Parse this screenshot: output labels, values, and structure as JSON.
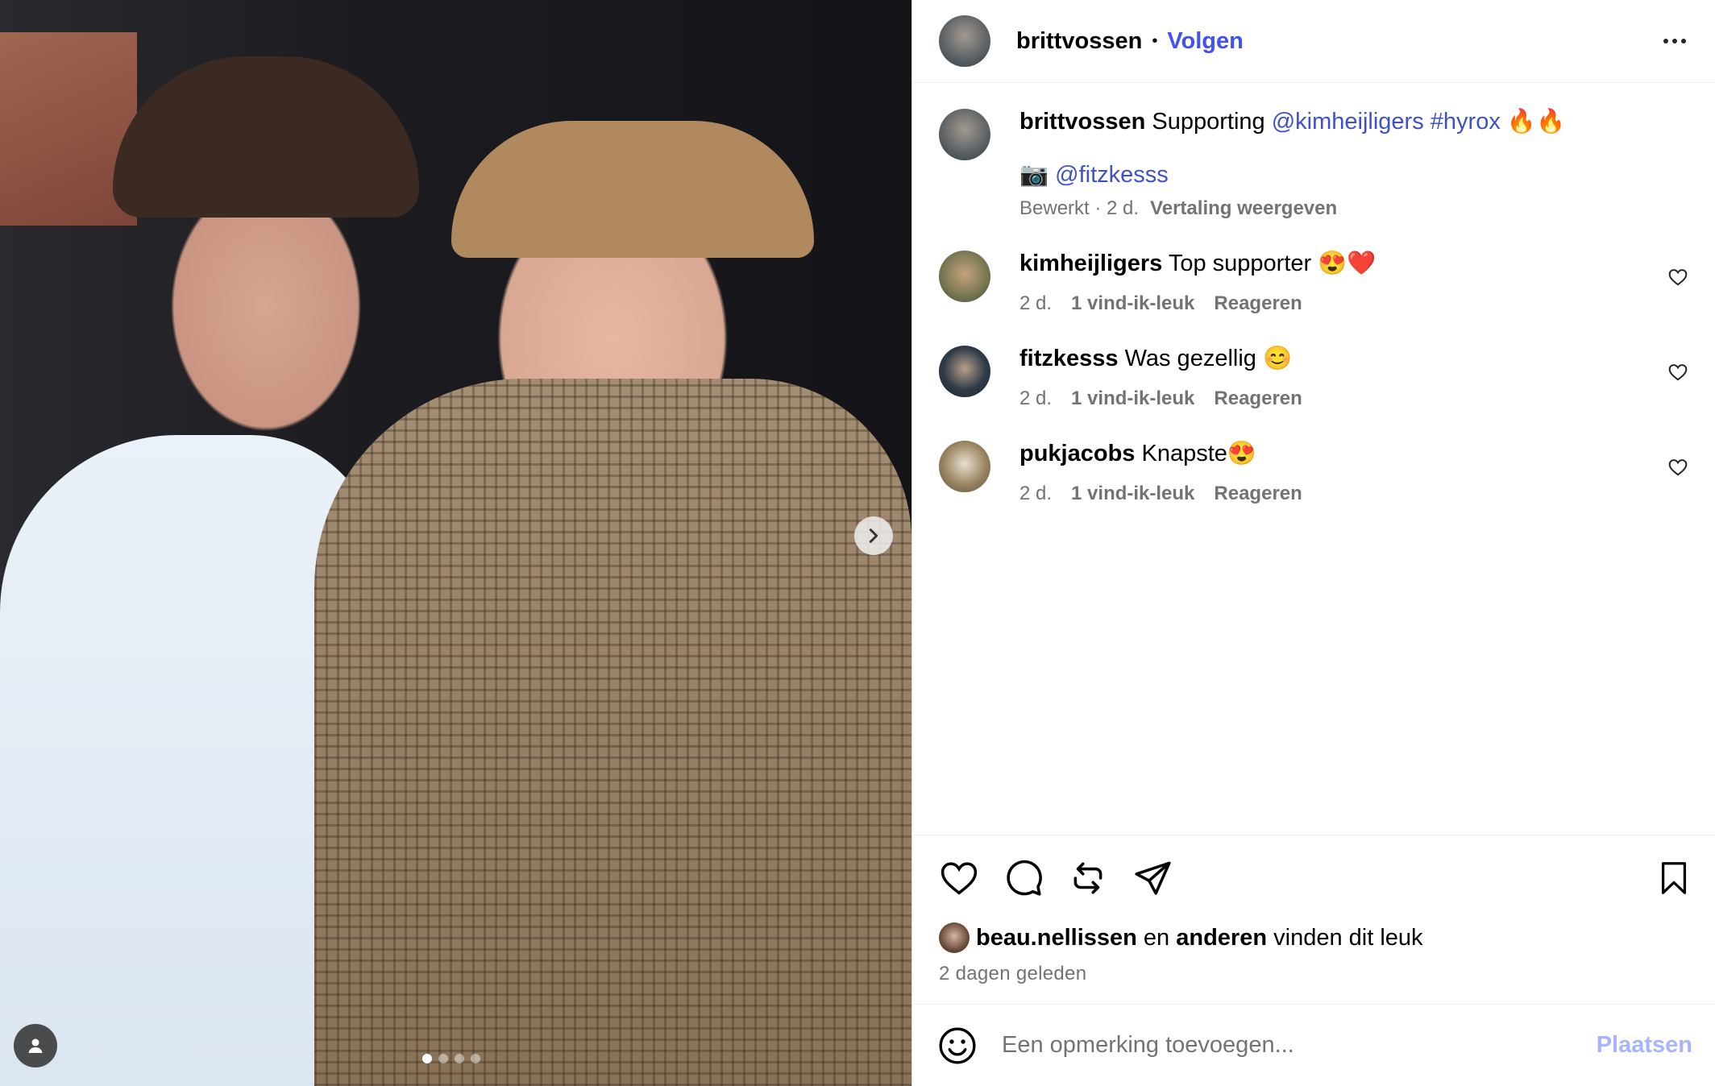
{
  "post": {
    "author": "brittvossen",
    "separator": "•",
    "follow_label": "Volgen",
    "carousel": {
      "slides": 4,
      "active_index": 0
    }
  },
  "caption": {
    "username": "brittvossen",
    "text": "Supporting",
    "mention": "@kimheijligers",
    "hashtag": "#hyrox",
    "emoji": "🔥🔥",
    "camera_emoji": "📷",
    "photo_credit": "@fitzkesss",
    "edited": "Bewerkt · 2 d.",
    "translate_label": "Vertaling weergeven"
  },
  "comments": [
    {
      "username": "kimheijligers",
      "text": "Top supporter 😍❤️",
      "age": "2 d.",
      "likes": "1 vind-ik-leuk",
      "reply": "Reageren"
    },
    {
      "username": "fitzkesss",
      "text": "Was gezellig 😊",
      "age": "2 d.",
      "likes": "1 vind-ik-leuk",
      "reply": "Reageren"
    },
    {
      "username": "pukjacobs",
      "text": "Knapste😍",
      "age": "2 d.",
      "likes": "1 vind-ik-leuk",
      "reply": "Reageren"
    }
  ],
  "likes": {
    "first_user": "beau.nellissen",
    "and": "en",
    "others": "anderen",
    "suffix": "vinden dit leuk"
  },
  "timestamp": "2 dagen geleden",
  "add_comment": {
    "placeholder": "Een opmerking toevoegen...",
    "post_label": "Plaatsen"
  },
  "colors": {
    "link": "#4150f7",
    "meta": "#737373",
    "post_disabled": "#a8b4ff"
  }
}
